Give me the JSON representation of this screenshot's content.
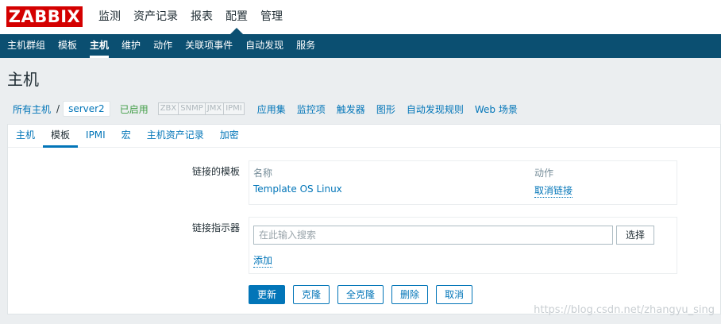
{
  "logo": {
    "text": "ZABBIX"
  },
  "top_menu": [
    {
      "label": "监测"
    },
    {
      "label": "资产记录"
    },
    {
      "label": "报表"
    },
    {
      "label": "配置"
    },
    {
      "label": "管理"
    }
  ],
  "sub_menu": [
    {
      "label": "主机群组"
    },
    {
      "label": "模板"
    },
    {
      "label": "主机"
    },
    {
      "label": "维护"
    },
    {
      "label": "动作"
    },
    {
      "label": "关联项事件"
    },
    {
      "label": "自动发现"
    },
    {
      "label": "服务"
    }
  ],
  "page_title": "主机",
  "host_nav": {
    "all_hosts": "所有主机",
    "separator": "/",
    "current_host": "server2",
    "status": "已启用",
    "availability": [
      "ZBX",
      "SNMP",
      "JMX",
      "IPMI"
    ],
    "links": [
      "应用集",
      "监控项",
      "触发器",
      "图形",
      "自动发现规则",
      "Web 场景"
    ]
  },
  "tabs": [
    {
      "label": "主机"
    },
    {
      "label": "模板"
    },
    {
      "label": "IPMI"
    },
    {
      "label": "宏"
    },
    {
      "label": "主机资产记录"
    },
    {
      "label": "加密"
    }
  ],
  "form": {
    "linked_templates_label": "链接的模板",
    "linked_table": {
      "col_name": "名称",
      "col_action": "动作",
      "rows": [
        {
          "name": "Template OS Linux",
          "action": "取消链接"
        }
      ]
    },
    "link_indicator_label": "链接指示器",
    "search_placeholder": "在此输入搜索",
    "select_button": "选择",
    "add_link": "添加"
  },
  "buttons": {
    "update": "更新",
    "clone": "克隆",
    "full_clone": "全克隆",
    "delete": "删除",
    "cancel": "取消"
  },
  "watermark": "https://blog.csdn.net/zhangyu_sing",
  "colors": {
    "brand_red": "#d40000",
    "nav_dark": "#0b4f71",
    "link_blue": "#0275b8",
    "enabled_green": "#429e47",
    "page_bg": "#ebeef0"
  }
}
